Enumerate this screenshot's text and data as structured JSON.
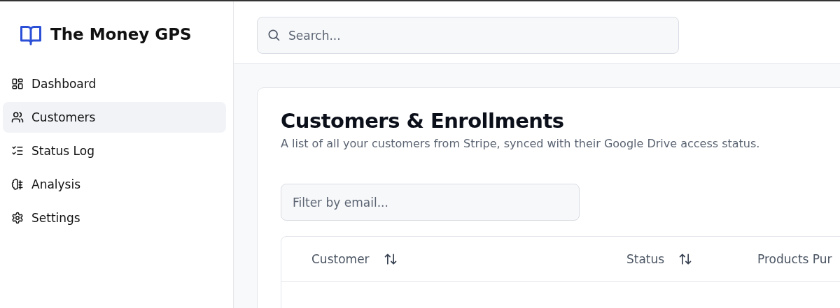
{
  "brand": {
    "name": "The Money GPS"
  },
  "sidebar": {
    "items": [
      {
        "label": "Dashboard",
        "kind": "dashboard",
        "selected": false
      },
      {
        "label": "Customers",
        "kind": "users",
        "selected": true
      },
      {
        "label": "Status Log",
        "kind": "checklist",
        "selected": false
      },
      {
        "label": "Analysis",
        "kind": "brain",
        "selected": false
      },
      {
        "label": "Settings",
        "kind": "gear",
        "selected": false
      }
    ]
  },
  "search": {
    "placeholder": "Search..."
  },
  "page": {
    "title": "Customers & Enrollments",
    "subtitle": "A list of all your customers from Stripe, synced with their Google Drive access status."
  },
  "filter": {
    "placeholder": "Filter by email..."
  },
  "table": {
    "columns": [
      {
        "label": "Customer",
        "sortable": true
      },
      {
        "label": "Status",
        "sortable": true
      },
      {
        "label": "Products Pur",
        "sortable": false
      }
    ]
  }
}
